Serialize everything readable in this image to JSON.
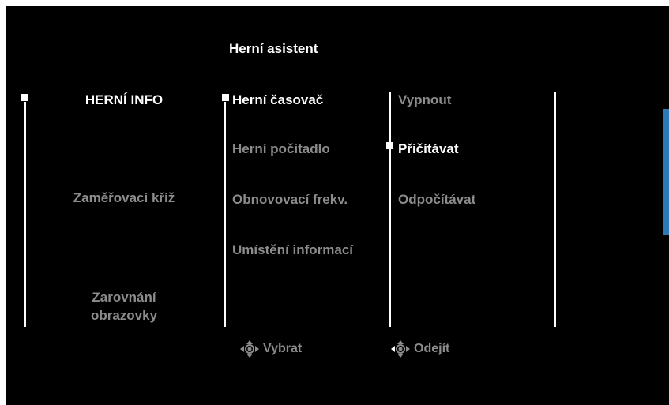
{
  "title": "Herní asistent",
  "columns": {
    "main": [
      {
        "label": "HERNÍ INFO",
        "state": "selected"
      },
      {
        "label": "Zaměřovací kříž",
        "state": "inactive"
      },
      {
        "label": "Zarovnání obrazovky",
        "state": "inactive"
      }
    ],
    "sub": [
      {
        "label": "Herní časovač",
        "state": "selected"
      },
      {
        "label": "Herní počitadlo",
        "state": "inactive"
      },
      {
        "label": "Obnovovací frekv.",
        "state": "inactive"
      },
      {
        "label": "Umístění informací",
        "state": "inactive"
      }
    ],
    "options": [
      {
        "label": "Vypnout",
        "state": "inactive"
      },
      {
        "label": "Přičítávat",
        "state": "selected"
      },
      {
        "label": "Odpočítávat",
        "state": "inactive"
      }
    ]
  },
  "footer": {
    "select": {
      "icon": "joystick-icon",
      "label": "Vybrat"
    },
    "exit": {
      "icon": "joystick-left-icon",
      "label": "Odejít"
    }
  },
  "colors": {
    "background": "#000000",
    "active": "#ffffff",
    "inactive": "#8c8c8c",
    "accent": "#2a7ab5"
  }
}
